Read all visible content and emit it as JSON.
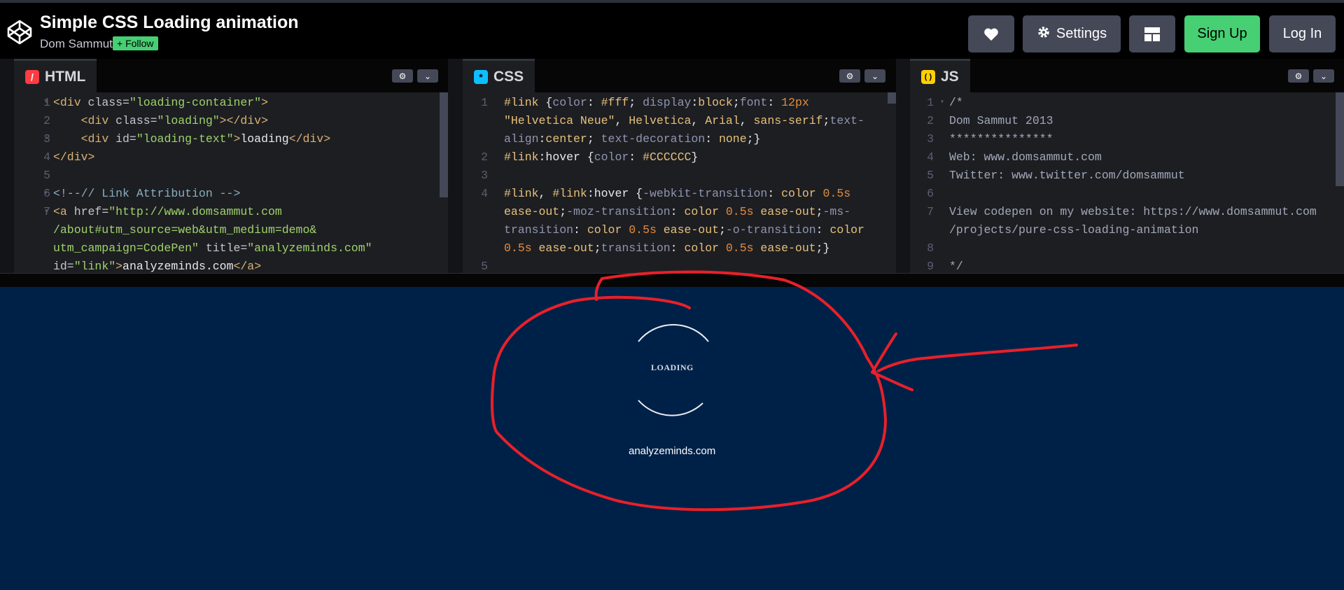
{
  "header": {
    "title": "Simple CSS Loading animation",
    "author": "Dom Sammut",
    "follow_label": "+ Follow",
    "settings_label": "Settings",
    "signup_label": "Sign Up",
    "login_label": "Log In"
  },
  "editors": {
    "html": {
      "label": "HTML",
      "icon": "/",
      "lines": [
        "1",
        "2",
        "3",
        "4",
        "5",
        "6",
        "7"
      ]
    },
    "css": {
      "label": "CSS",
      "icon": "*",
      "lines": [
        "1",
        "2",
        "3",
        "4",
        "5"
      ]
    },
    "js": {
      "label": "JS",
      "icon": "( )",
      "lines": [
        "1",
        "2",
        "3",
        "4",
        "5",
        "6",
        "7",
        "8",
        "9"
      ]
    }
  },
  "preview": {
    "loading_text": "LOADING",
    "link_text": "analyzeminds.com",
    "background": "#002147"
  },
  "colors": {
    "accent_green": "#47cf73",
    "button_gray": "#444857",
    "annotation_red": "#e8202a"
  }
}
